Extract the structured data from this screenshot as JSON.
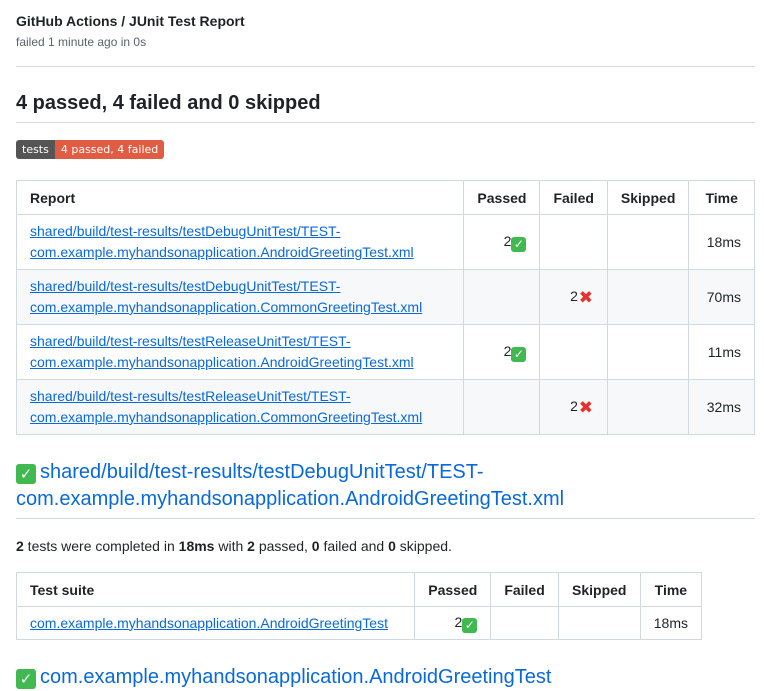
{
  "header": {
    "title": "GitHub Actions / JUnit Test Report",
    "subtitle": "failed 1 minute ago in 0s"
  },
  "summary": "4 passed, 4 failed and 0 skipped",
  "badge": {
    "left": "tests",
    "right": "4 passed, 4 failed"
  },
  "report_table": {
    "headers": [
      "Report",
      "Passed",
      "Failed",
      "Skipped",
      "Time"
    ],
    "rows": [
      {
        "line1": "shared/build/test-results/testDebugUnitTest/TEST-",
        "line2": "com.example.myhandsonapplication.AndroidGreetingTest.xml",
        "passed": "2",
        "failed": "",
        "skipped": "",
        "time": "18ms"
      },
      {
        "line1": "shared/build/test-results/testDebugUnitTest/TEST-",
        "line2": "com.example.myhandsonapplication.CommonGreetingTest.xml",
        "passed": "",
        "failed": "2",
        "skipped": "",
        "time": "70ms"
      },
      {
        "line1": "shared/build/test-results/testReleaseUnitTest/TEST-",
        "line2": "com.example.myhandsonapplication.AndroidGreetingTest.xml",
        "passed": "2",
        "failed": "",
        "skipped": "",
        "time": "11ms"
      },
      {
        "line1": "shared/build/test-results/testReleaseUnitTest/TEST-",
        "line2": "com.example.myhandsonapplication.CommonGreetingTest.xml",
        "passed": "",
        "failed": "2",
        "skipped": "",
        "time": "32ms"
      }
    ]
  },
  "section1": {
    "line1": "shared/build/test-results/testDebugUnitTest/TEST-",
    "line2": "com.example.myhandsonapplication.AndroidGreetingTest.xml",
    "stats": {
      "total": "2",
      "a": " tests were completed in ",
      "time": "18ms",
      "b": " with ",
      "passed": "2",
      "c": " passed, ",
      "failed": "0",
      "d": " failed and ",
      "skipped": "0",
      "e": " skipped."
    }
  },
  "suite_table": {
    "headers": [
      "Test suite",
      "Passed",
      "Failed",
      "Skipped",
      "Time"
    ],
    "rows": [
      {
        "name": "com.example.myhandsonapplication.AndroidGreetingTest",
        "passed": "2",
        "failed": "",
        "skipped": "",
        "time": "18ms"
      }
    ]
  },
  "section2": {
    "title": "com.example.myhandsonapplication.AndroidGreetingTest"
  },
  "icons": {
    "pass": "check-mark-button-icon",
    "fail": "cross-mark-icon"
  }
}
